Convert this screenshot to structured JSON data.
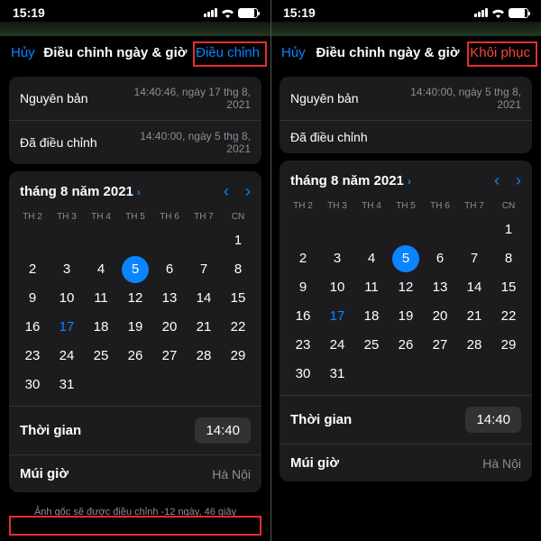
{
  "left": {
    "status_time": "15:19",
    "nav": {
      "cancel": "Hủy",
      "title": "Điều chỉnh ngày & giờ",
      "action": "Điều chỉnh"
    },
    "info": {
      "original_label": "Nguyên bản",
      "original_value": "14:40:46, ngày 17 thg 8, 2021",
      "adjusted_label": "Đã điều chỉnh",
      "adjusted_value": "14:40:00, ngày 5 thg 8, 2021"
    },
    "calendar": {
      "month": "tháng 8 năm 2021",
      "weekdays": [
        "TH 2",
        "TH 3",
        "TH 4",
        "TH 5",
        "TH 6",
        "TH 7",
        "CN"
      ],
      "time_label": "Thời gian",
      "time_value": "14:40",
      "tz_label": "Múi giờ",
      "tz_value": "Hà Nội"
    },
    "footer": "Ảnh gốc sẽ được điều chỉnh -12 ngày, 46 giây"
  },
  "right": {
    "status_time": "15:19",
    "nav": {
      "cancel": "Hủy",
      "title": "Điều chỉnh ngày & giờ",
      "action": "Khôi phục"
    },
    "info": {
      "original_label": "Nguyên bản",
      "original_value": "14:40:00, ngày 5 thg 8, 2021",
      "adjusted_label": "Đã điều chỉnh"
    },
    "calendar": {
      "month": "tháng 8 năm 2021",
      "weekdays": [
        "TH 2",
        "TH 3",
        "TH 4",
        "TH 5",
        "TH 6",
        "TH 7",
        "CN"
      ],
      "time_label": "Thời gian",
      "time_value": "14:40",
      "tz_label": "Múi giờ",
      "tz_value": "Hà Nội"
    }
  },
  "days": [
    "",
    "",
    "",
    "",
    "",
    "",
    "1",
    "2",
    "3",
    "4",
    "5",
    "6",
    "7",
    "8",
    "9",
    "10",
    "11",
    "12",
    "13",
    "14",
    "15",
    "16",
    "17",
    "18",
    "19",
    "20",
    "21",
    "22",
    "23",
    "24",
    "25",
    "26",
    "27",
    "28",
    "29",
    "30",
    "31",
    "",
    "",
    "",
    "",
    ""
  ]
}
